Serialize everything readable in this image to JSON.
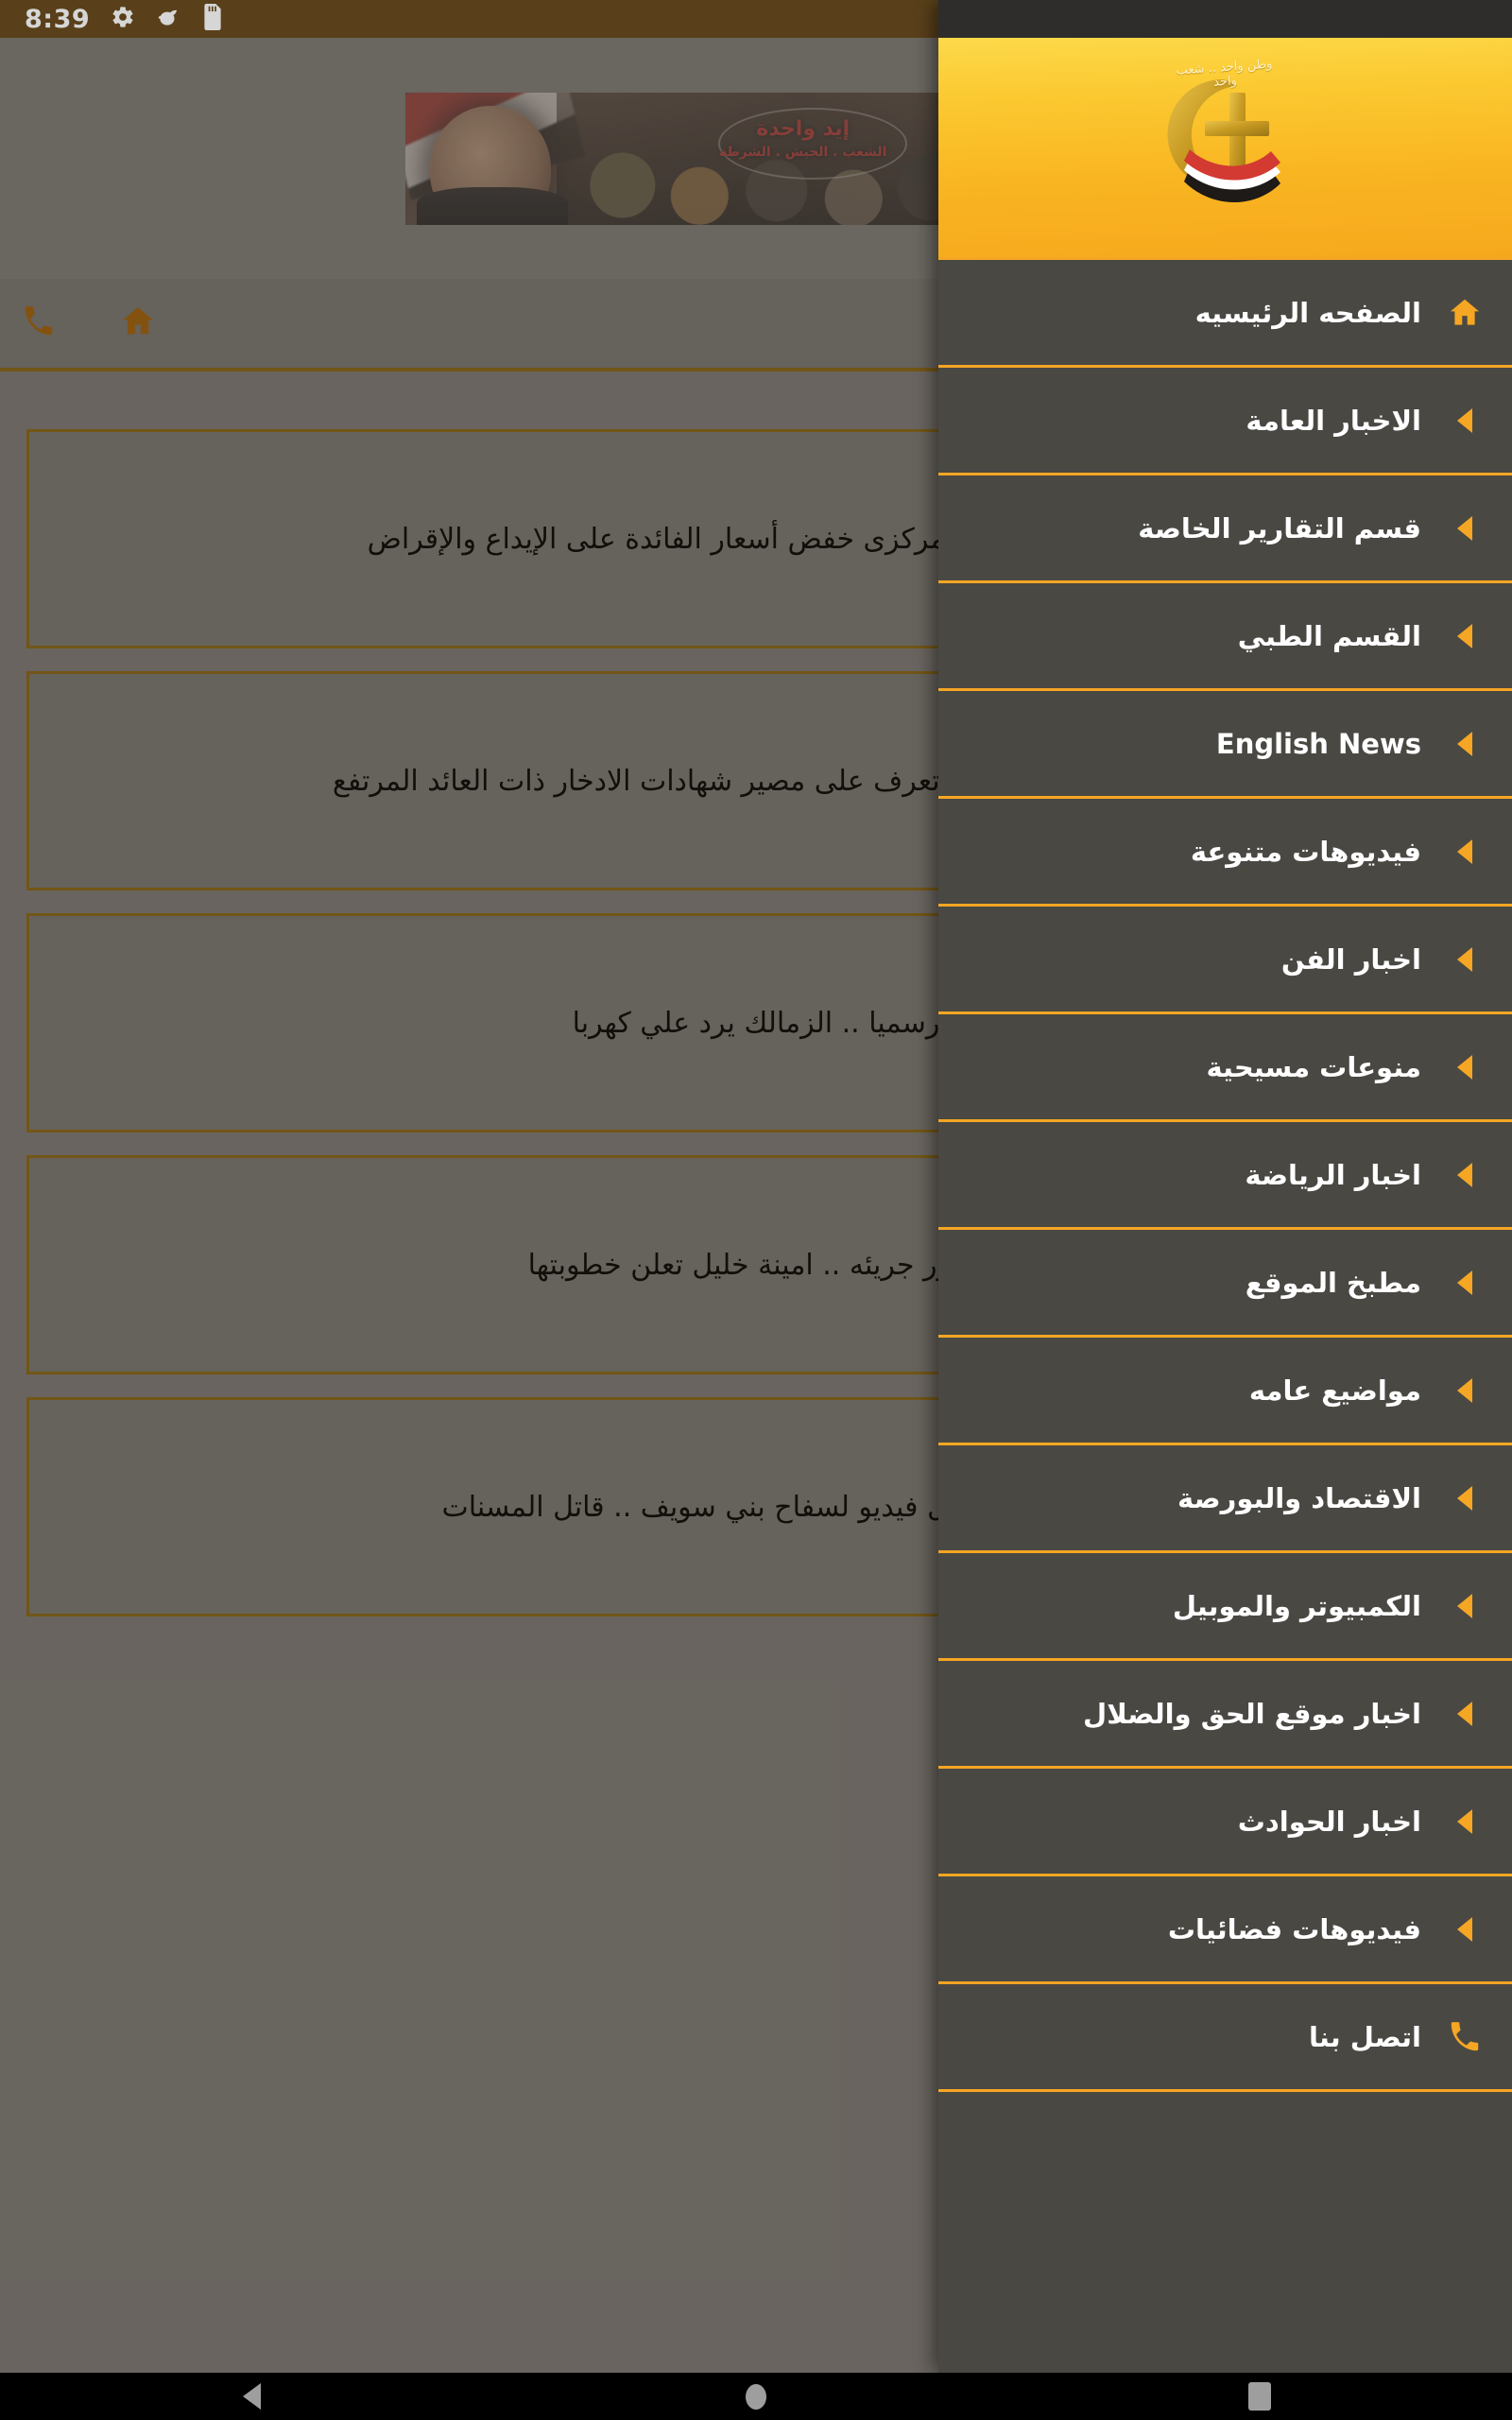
{
  "status_bar": {
    "time": "8:39",
    "left_icons": [
      "gear-icon",
      "debug-bug-icon",
      "sd-card-icon"
    ],
    "right_icons": [
      "wifi-icon",
      "signal-icon",
      "battery-icon"
    ],
    "background_color": "#6a4d20"
  },
  "app": {
    "toolbar": {
      "icons": [
        "phone-icon",
        "home-icon"
      ],
      "icon_color": "#a4650f"
    },
    "banner": {
      "headline": "إيد واحدة",
      "subline": "الشعب . الجيش . الشرطة"
    },
    "news_cards": [
      {
        "title": "لماذا قرر البنك المركزى خفض أسعار الفائدة على الإيداع والإقراض"
      },
      {
        "title": "قرار خفض الفائدة ..تعرف على مصير شهادات الادخار ذات العائد المرتفع"
      },
      {
        "title": "رسميا .. الزمالك يرد علي كهربا"
      },
      {
        "title": "بصور جريئه .. امينة خليل تعلن خطوبتها"
      },
      {
        "title": "خطير .. اول فيديو لسفاح بني سويف .. قاتل المسنات"
      }
    ]
  },
  "drawer": {
    "header": {
      "logo_name": "crescent-cross-egypt-flag-logo",
      "logo_arc_text": "وطن واحد .. شعب واحد",
      "gradient_from": "#fdd94a",
      "gradient_to": "#f6a81d"
    },
    "accent_color": "#f5a623",
    "background_color": "#4a4843",
    "items": [
      {
        "label": "الصفحه الرئيسيه",
        "icon": "home-icon"
      },
      {
        "label": "الاخبار العامة",
        "icon": "caret-left-icon"
      },
      {
        "label": "قسم التقارير الخاصة",
        "icon": "caret-left-icon"
      },
      {
        "label": "القسم الطبي",
        "icon": "caret-left-icon"
      },
      {
        "label": "English News",
        "icon": "caret-left-icon",
        "latin": true
      },
      {
        "label": "فيديوهات متنوعة",
        "icon": "caret-left-icon"
      },
      {
        "label": "اخبار الفن",
        "icon": "caret-left-icon"
      },
      {
        "label": "منوعات مسيحية",
        "icon": "caret-left-icon"
      },
      {
        "label": "اخبار الرياضة",
        "icon": "caret-left-icon"
      },
      {
        "label": "مطبخ الموقع",
        "icon": "caret-left-icon"
      },
      {
        "label": "مواضيع عامه",
        "icon": "caret-left-icon"
      },
      {
        "label": "الاقتصاد والبورصة",
        "icon": "caret-left-icon"
      },
      {
        "label": "الكمبيوتر والموبيل",
        "icon": "caret-left-icon"
      },
      {
        "label": "اخبار موقع الحق والضلال",
        "icon": "caret-left-icon"
      },
      {
        "label": "اخبار الحوادث",
        "icon": "caret-left-icon"
      },
      {
        "label": "فيديوهات فضائيات",
        "icon": "caret-left-icon"
      },
      {
        "label": "اتصل بنا",
        "icon": "phone-icon"
      }
    ]
  },
  "navbar": {
    "buttons": [
      "back-icon",
      "home-icon",
      "recents-icon"
    ]
  }
}
